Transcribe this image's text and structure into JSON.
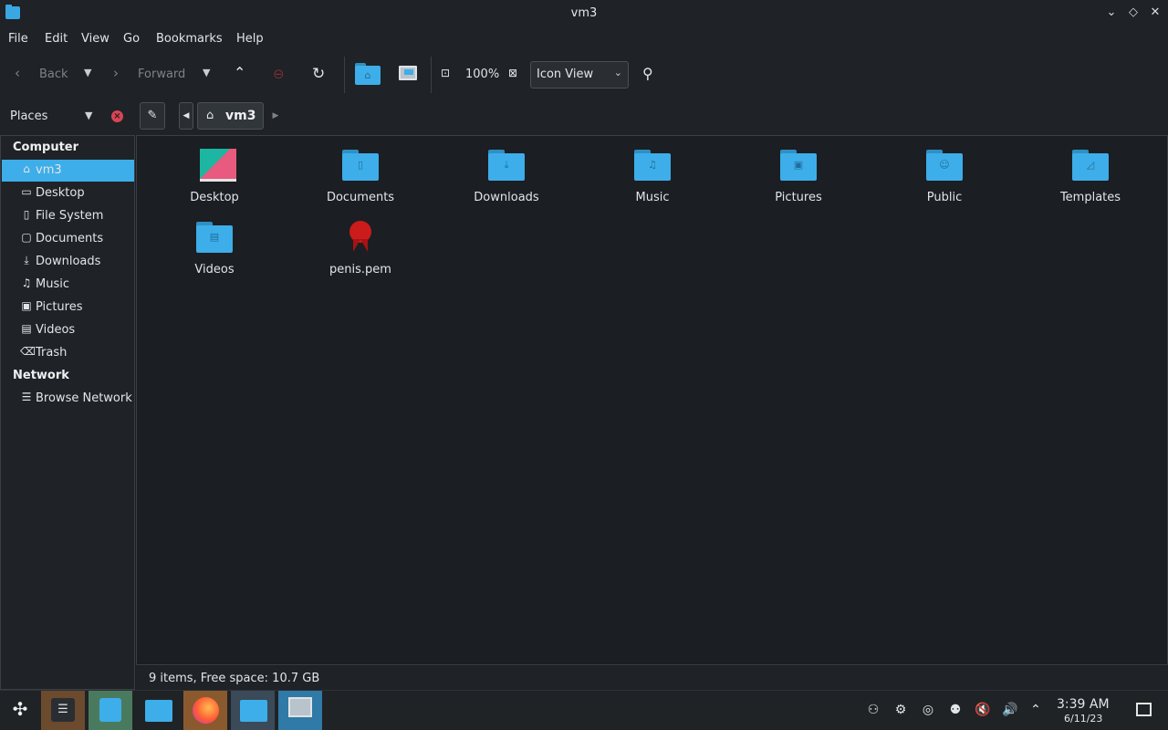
{
  "window": {
    "title": "vm3"
  },
  "menu": [
    "File",
    "Edit",
    "View",
    "Go",
    "Bookmarks",
    "Help"
  ],
  "toolbar": {
    "back_label": "Back",
    "forward_label": "Forward",
    "zoom": "100%",
    "view_mode": "Icon View"
  },
  "sidebar": {
    "title": "Places",
    "sections": [
      {
        "header": "Computer",
        "items": [
          {
            "label": "vm3",
            "icon": "home-icon",
            "selected": true
          },
          {
            "label": "Desktop",
            "icon": "desktop-icon"
          },
          {
            "label": "File System",
            "icon": "drive-icon"
          },
          {
            "label": "Documents",
            "icon": "documents-icon"
          },
          {
            "label": "Downloads",
            "icon": "download-icon"
          },
          {
            "label": "Music",
            "icon": "music-icon"
          },
          {
            "label": "Pictures",
            "icon": "picture-icon"
          },
          {
            "label": "Videos",
            "icon": "video-icon"
          },
          {
            "label": "Trash",
            "icon": "trash-icon"
          }
        ]
      },
      {
        "header": "Network",
        "items": [
          {
            "label": "Browse Network",
            "icon": "network-icon"
          }
        ]
      }
    ]
  },
  "breadcrumb": {
    "current": "vm3"
  },
  "files": [
    {
      "name": "Desktop",
      "icon": "desktop-folder-icon"
    },
    {
      "name": "Documents",
      "icon": "documents-folder-icon"
    },
    {
      "name": "Downloads",
      "icon": "downloads-folder-icon"
    },
    {
      "name": "Music",
      "icon": "music-folder-icon"
    },
    {
      "name": "Pictures",
      "icon": "pictures-folder-icon"
    },
    {
      "name": "Public",
      "icon": "public-folder-icon"
    },
    {
      "name": "Templates",
      "icon": "templates-folder-icon"
    },
    {
      "name": "Videos",
      "icon": "videos-folder-icon"
    },
    {
      "name": "penis.pem",
      "icon": "certificate-icon"
    }
  ],
  "status": "9 items, Free space: 10.7 GB",
  "taskbar": {
    "clock_time": "3:39 AM",
    "clock_date": "6/11/23"
  },
  "colors": {
    "accent": "#3daee9",
    "folder": "#3daee9",
    "close": "#da4453"
  }
}
